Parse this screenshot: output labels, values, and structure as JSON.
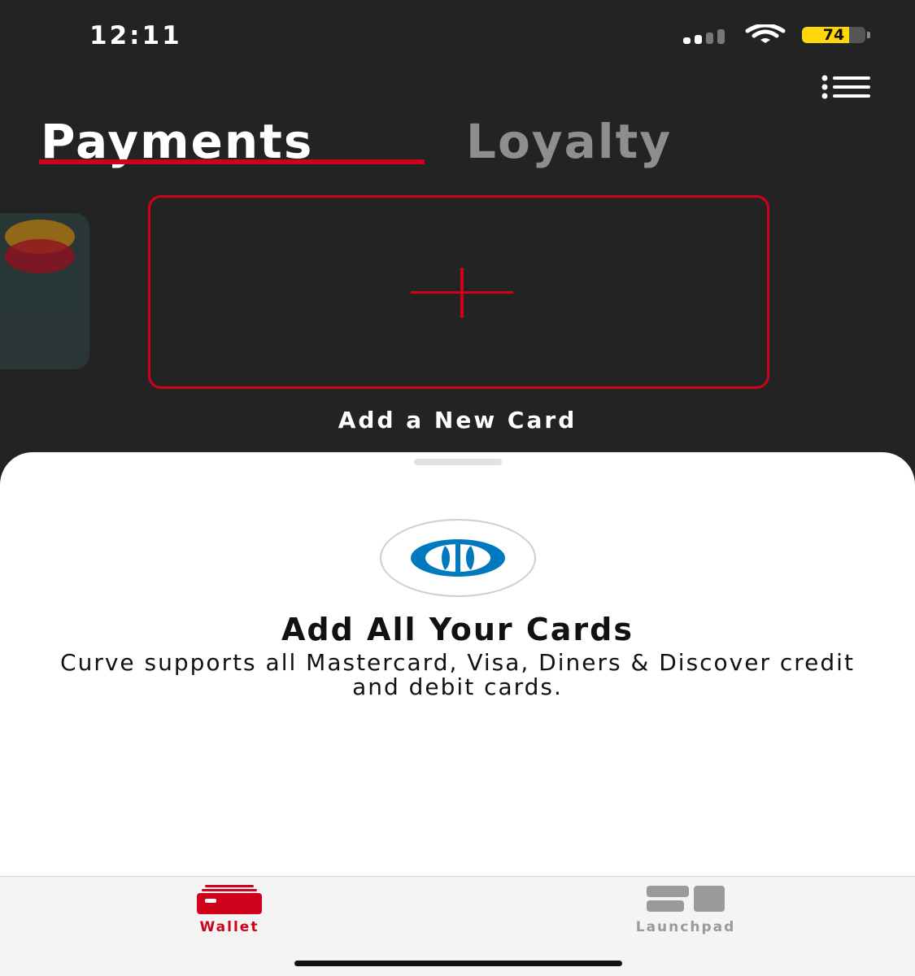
{
  "status_bar": {
    "time": "12:11",
    "battery_level": "74",
    "battery_color": "#ffd60a",
    "signal_icon": "cellular-signal-icon",
    "wifi_icon": "wifi-icon"
  },
  "header": {
    "menu_icon": "list-menu-icon",
    "tabs": [
      {
        "label": "Payments",
        "active": true
      },
      {
        "label": "Loyalty",
        "active": false
      }
    ]
  },
  "carousel": {
    "add_card_label": "Add a New Card",
    "plus_icon": "plus-icon",
    "side_card_brand": "mastercard-logo"
  },
  "sheet": {
    "logo": "diners-club-logo",
    "title": "Add All Your Cards",
    "description": "Curve supports all Mastercard, Visa, Diners & Discover credit and debit cards."
  },
  "tab_bar": {
    "items": [
      {
        "label": "Wallet",
        "icon": "wallet-icon",
        "active": true
      },
      {
        "label": "Launchpad",
        "icon": "launchpad-icon",
        "active": false
      }
    ]
  },
  "colors": {
    "accent": "#d0021b",
    "background": "#232323",
    "sheet": "#ffffff",
    "inactive": "#8e8e8e"
  }
}
